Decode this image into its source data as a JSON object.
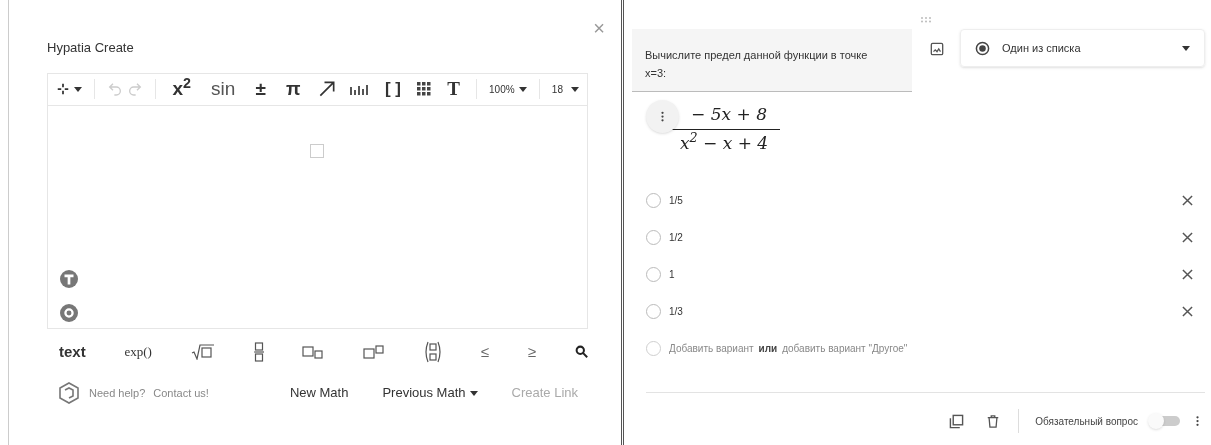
{
  "editor": {
    "title": "Hypatia Create",
    "close": "×",
    "toolbar": {
      "superscript": "x$^{2}$",
      "function": "sin",
      "plus_minus": "±",
      "pi": "π",
      "brackets": "[ ]",
      "text_style": "T",
      "zoom": "100%",
      "font_size": "18",
      "history_enabled": false
    },
    "palette": {
      "text": "text",
      "exp": "exp()",
      "le": "≤",
      "ge": "≥"
    },
    "help": "Need help?",
    "contact": "Contact us!",
    "buttons": [
      {
        "label": "New Math",
        "dropdown": false,
        "disabled": false
      },
      {
        "label": "Previous Math",
        "dropdown": true,
        "disabled": false
      },
      {
        "label": "Create Link",
        "dropdown": false,
        "disabled": true
      }
    ]
  },
  "question": {
    "text": "Вычислите предел данной функции в точке x=3:",
    "type": "Один из списка",
    "formula": {
      "numerator": "− 5x + 8",
      "denominator": "x$^{2}$ − x + 4"
    },
    "options": [
      {
        "label": "1/5",
        "selected": false
      },
      {
        "label": "1/2",
        "selected": false
      },
      {
        "label": "1",
        "selected": false
      },
      {
        "label": "1/3",
        "selected": false
      }
    ],
    "add_option": "Добавить вариант",
    "or": "или",
    "add_other": "добавить вариант \"Другое\"",
    "required_label": "Обязательный вопрос",
    "required": false
  }
}
